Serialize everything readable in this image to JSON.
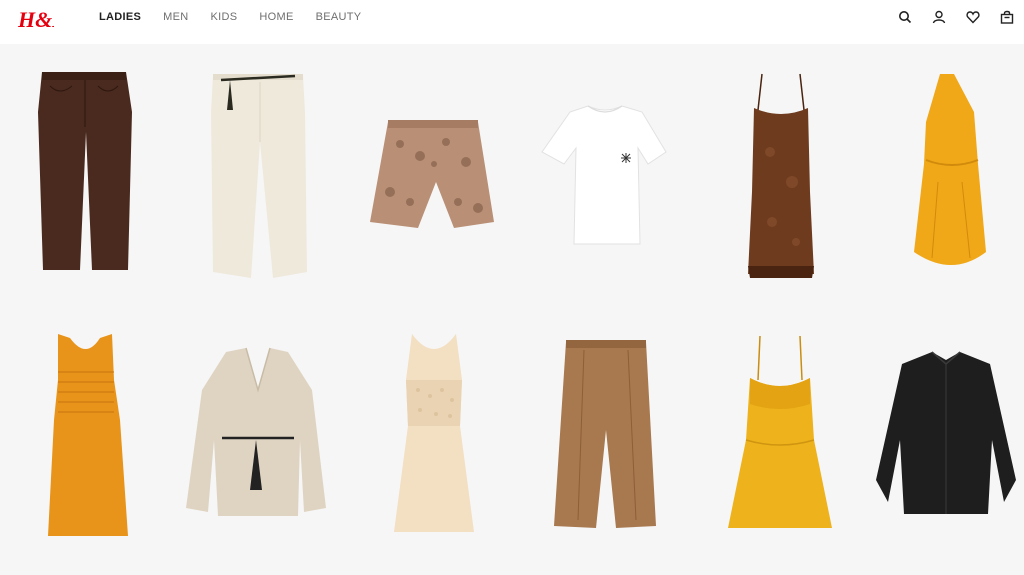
{
  "brand": {
    "logo_text": "H&M",
    "color": "#e50010"
  },
  "nav": {
    "items": [
      {
        "label": "LADIES",
        "active": true
      },
      {
        "label": "MEN",
        "active": false
      },
      {
        "label": "KIDS",
        "active": false
      },
      {
        "label": "HOME",
        "active": false
      },
      {
        "label": "BEAUTY",
        "active": false
      }
    ]
  },
  "header_icons": [
    "search-icon",
    "account-icon",
    "favorites-icon",
    "shopping-bag-icon"
  ],
  "products": [
    {
      "icon": "brown-jeans",
      "color": "#4a2a1e"
    },
    {
      "icon": "cream-trousers",
      "color": "#efe9dc"
    },
    {
      "icon": "snakeskin-shorts",
      "color": "#b98f76"
    },
    {
      "icon": "white-tshirt",
      "color": "#ffffff"
    },
    {
      "icon": "brown-slip-dress",
      "color": "#6e3b1f"
    },
    {
      "icon": "yellow-one-shoulder-dress",
      "color": "#f0a818"
    },
    {
      "icon": "orange-smocked-dress",
      "color": "#e8941a"
    },
    {
      "icon": "beige-blazer",
      "color": "#dfd4c2"
    },
    {
      "icon": "crochet-maxi-dress",
      "color": "#f3dfc2"
    },
    {
      "icon": "brown-shorts",
      "color": "#a8784e"
    },
    {
      "icon": "yellow-lace-dress",
      "color": "#eeb21c"
    },
    {
      "icon": "black-blouse",
      "color": "#1e1e1e"
    }
  ]
}
